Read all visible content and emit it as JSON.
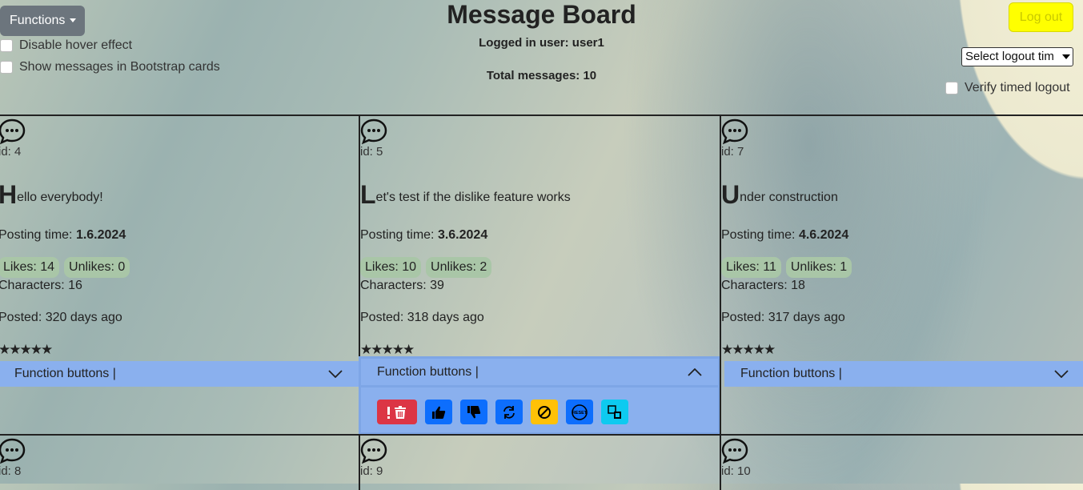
{
  "header": {
    "functions_label": "Functions",
    "disable_hover": "Disable hover effect",
    "show_cards": "Show messages in Bootstrap cards",
    "title": "Message Board",
    "logged_user": "Logged in user: user1",
    "total_messages": "Total messages: 10",
    "logout_label": "Log out",
    "logout_select": "Select logout tim",
    "verify_logout": "Verify timed logout"
  },
  "messages": [
    {
      "id": "id: 4",
      "first": "H",
      "rest": "ello everybody!",
      "ptime_label": "Posting time: ",
      "ptime": "1.6.2024",
      "likes": "Likes: 14",
      "unlikes": "Unlikes: 0",
      "chars": "Characters: 16",
      "posted": "Posted: 320 days ago",
      "stars": "★★★★★",
      "func": "Function buttons |"
    },
    {
      "id": "id: 5",
      "first": "L",
      "rest": "et's test if the dislike feature works",
      "ptime_label": "Posting time: ",
      "ptime": "3.6.2024",
      "likes": "Likes: 10",
      "unlikes": "Unlikes: 2",
      "chars": "Characters: 39",
      "posted": "Posted: 318 days ago",
      "stars": "★★★★★",
      "func": "Function buttons |"
    },
    {
      "id": "id: 7",
      "first": "U",
      "rest": "nder construction",
      "ptime_label": "Posting time: ",
      "ptime": "4.6.2024",
      "likes": "Likes: 11",
      "unlikes": "Unlikes: 1",
      "chars": "Characters: 18",
      "posted": "Posted: 317 days ago",
      "stars": "★★★★★",
      "func": "Function buttons |"
    },
    {
      "id": "id: 8"
    },
    {
      "id": "id: 9"
    },
    {
      "id": "id: 10"
    }
  ],
  "function_buttons": {
    "delete_icon": "!🗑",
    "reset_text": "RESET"
  },
  "colors": {
    "functions_btn": "#6c757d",
    "logout_btn": "#ffff00",
    "function_bar": "#8ab0ee",
    "badge": "#a9c6a7",
    "danger": "#dc3545",
    "primary": "#0d6efd",
    "warning": "#ffc107",
    "info": "#0dcaf0"
  }
}
